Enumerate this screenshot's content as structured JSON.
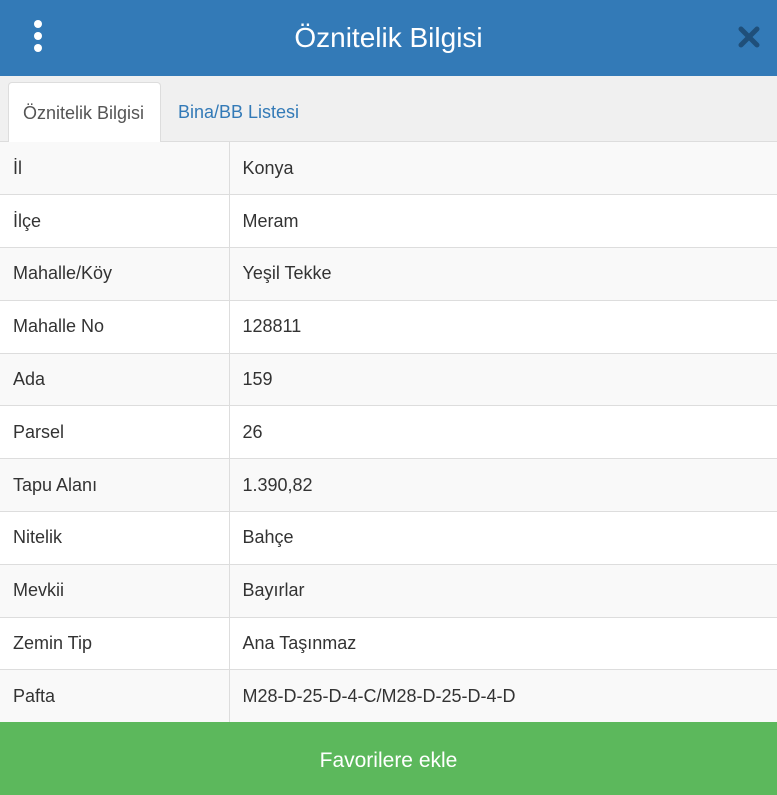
{
  "header": {
    "title": "Öznitelik Bilgisi",
    "menu_icon": "kebab-vertical-icon",
    "close_icon": "close-x-icon",
    "bg_color": "#337ab7"
  },
  "tabs": [
    {
      "label": "Öznitelik Bilgisi",
      "active": true
    },
    {
      "label": "Bina/BB Listesi",
      "active": false
    }
  ],
  "attributes": [
    {
      "key": "İl",
      "value": "Konya"
    },
    {
      "key": "İlçe",
      "value": "Meram"
    },
    {
      "key": "Mahalle/Köy",
      "value": "Yeşil Tekke"
    },
    {
      "key": "Mahalle No",
      "value": "128811"
    },
    {
      "key": "Ada",
      "value": "159"
    },
    {
      "key": "Parsel",
      "value": "26"
    },
    {
      "key": "Tapu Alanı",
      "value": "1.390,82"
    },
    {
      "key": "Nitelik",
      "value": "Bahçe"
    },
    {
      "key": "Mevkii",
      "value": "Bayırlar"
    },
    {
      "key": "Zemin Tip",
      "value": "Ana Taşınmaz"
    },
    {
      "key": "Pafta",
      "value": "M28-D-25-D-4-C/M28-D-25-D-4-D"
    }
  ],
  "footer": {
    "favorite_label": "Favorilere ekle",
    "bg_color": "#5cb85c"
  }
}
